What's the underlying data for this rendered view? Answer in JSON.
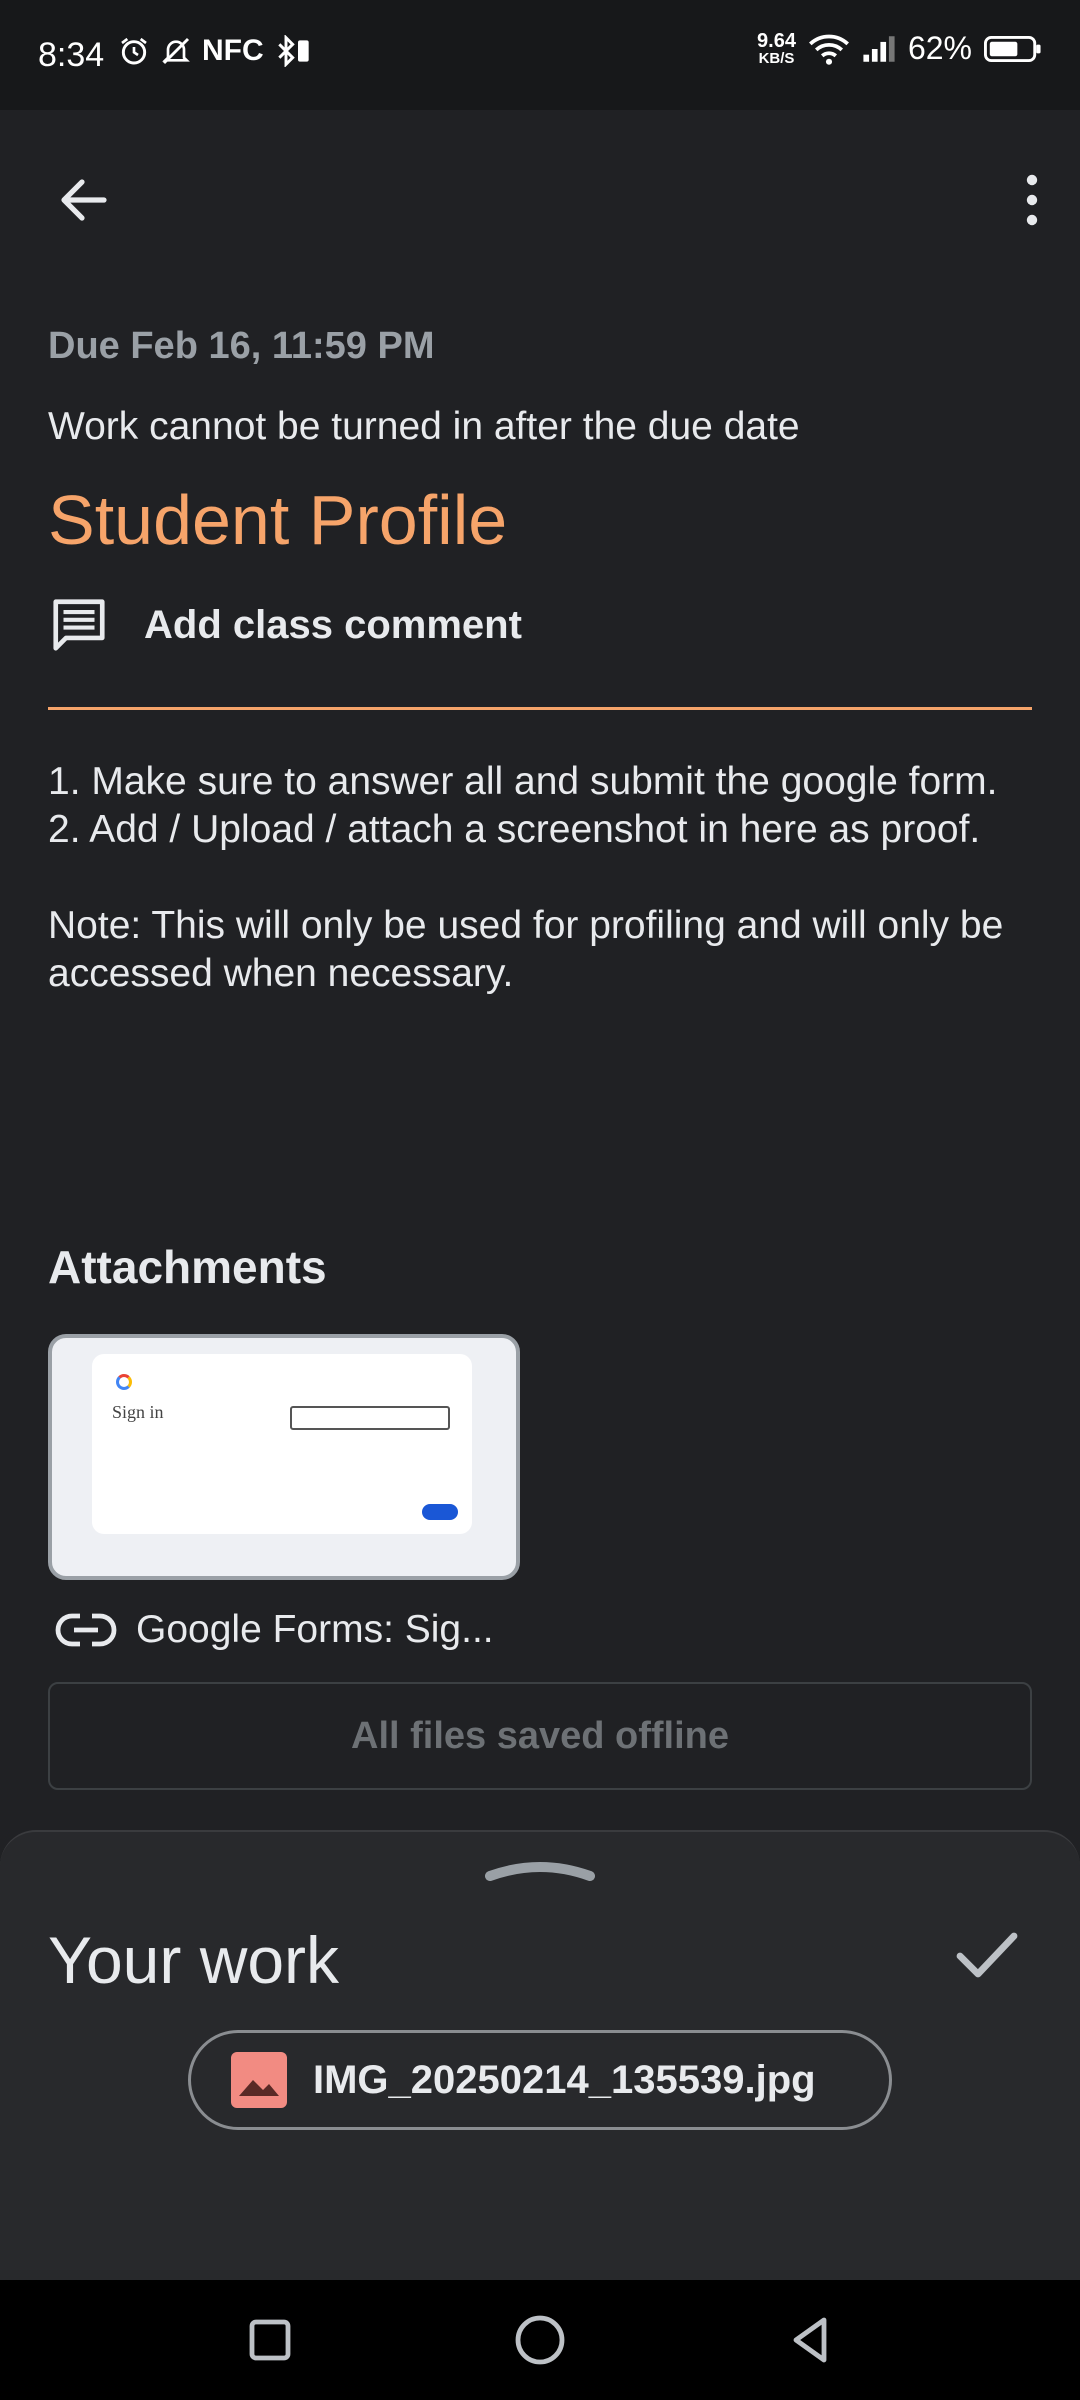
{
  "status_bar": {
    "time": "8:34",
    "nfc": "NFC",
    "net_speed_value": "9.64",
    "net_speed_unit": "KB/S",
    "battery": "62%"
  },
  "assignment": {
    "due": "Due Feb 16, 11:59 PM",
    "late_note": "Work cannot be turned in after the due date",
    "title": "Student Profile",
    "add_comment_label": "Add class comment",
    "instructions": "1. Make sure to answer all and submit the google form.\n2. Add / Upload / attach a screenshot in here as proof.\n\nNote: This will only be used for profiling and will only be accessed when necessary.",
    "accent_color": "#f6a46a"
  },
  "attachments": {
    "heading": "Attachments",
    "items": [
      {
        "label": "Google Forms: Sig...",
        "thumbnail_text": "Sign in"
      }
    ],
    "offline_status": "All files saved offline"
  },
  "your_work": {
    "title": "Your work",
    "files": [
      {
        "name": "IMG_20250214_135539.jpg",
        "icon": "image-icon"
      }
    ]
  },
  "icons": {
    "back": "arrow-left-icon",
    "more": "more-vert-icon",
    "comment": "comment-icon",
    "link": "link-icon",
    "check": "check-icon",
    "handle": "chevron-up-icon"
  }
}
